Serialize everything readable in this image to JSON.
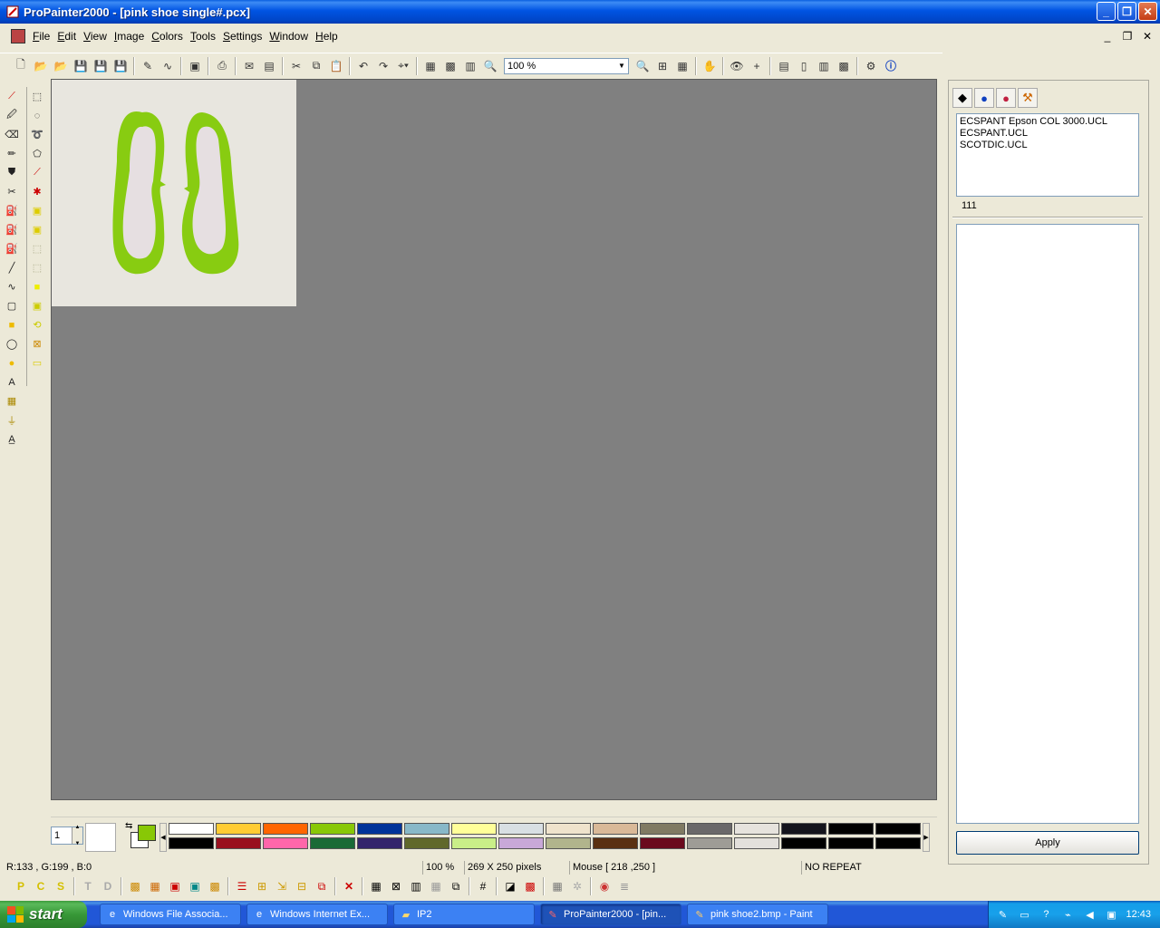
{
  "window": {
    "title": "ProPainter2000 - [pink shoe single#.pcx]",
    "controls": {
      "minimize": "_",
      "maximize": "❐",
      "close": "✕"
    }
  },
  "menu": {
    "items": [
      "File",
      "Edit",
      "View",
      "Image",
      "Colors",
      "Tools",
      "Settings",
      "Window",
      "Help"
    ]
  },
  "toolbar": {
    "zoom_value": "100 %"
  },
  "colors": {
    "workspace": "#808080",
    "canvas_bg": "#e8e6df",
    "shoe_green": "#88cc11",
    "shoe_lining": "#e6dfe1",
    "current_fg": "#88c806"
  },
  "palette": {
    "pen_size": "1",
    "row1": [
      "#ffffff",
      "#ffcc33",
      "#ff6600",
      "#88c806",
      "#003399",
      "#88b8c8",
      "#ffff99",
      "#d8dfe3",
      "#efe3cc",
      "#d9b998",
      "#807a63",
      "#6a6869",
      "#e6e3dd",
      "#14141c",
      "#000000",
      "#000000"
    ],
    "row2": [
      "#000000",
      "#990f1e",
      "#ff66aa",
      "#1a6a36",
      "#33246b",
      "#60682b",
      "#c9ee88",
      "#c8a8d8",
      "#b1b48c",
      "#5a3012",
      "#6a0a1e",
      "#9e9c96",
      "#e3e0dc",
      "#000000",
      "#000000",
      "#000000"
    ]
  },
  "status": {
    "rgb": "R:133 , G:199 , B:0",
    "zoom": "100 %",
    "size": "269 X 250 pixels",
    "mouse": "Mouse [ 218 ,250 ]",
    "repeat": "NO REPEAT"
  },
  "right_panel": {
    "files": [
      "ECSPANT Epson COL 3000.UCL",
      "ECSPANT.UCL",
      "SCOTDIC.UCL"
    ],
    "number": "111",
    "apply_label": "Apply"
  },
  "taskbar": {
    "start_label": "start",
    "tasks": [
      {
        "label": "Windows File Associa...",
        "icon": "ie-icon",
        "active": false
      },
      {
        "label": "Windows Internet Ex...",
        "icon": "ie-icon",
        "active": false
      },
      {
        "label": "IP2",
        "icon": "folder-icon",
        "active": false
      },
      {
        "label": "ProPainter2000 - [pin...",
        "icon": "propainter-icon",
        "active": true
      },
      {
        "label": "pink shoe2.bmp - Paint",
        "icon": "paint-icon",
        "active": false
      }
    ],
    "clock": "12:43"
  }
}
